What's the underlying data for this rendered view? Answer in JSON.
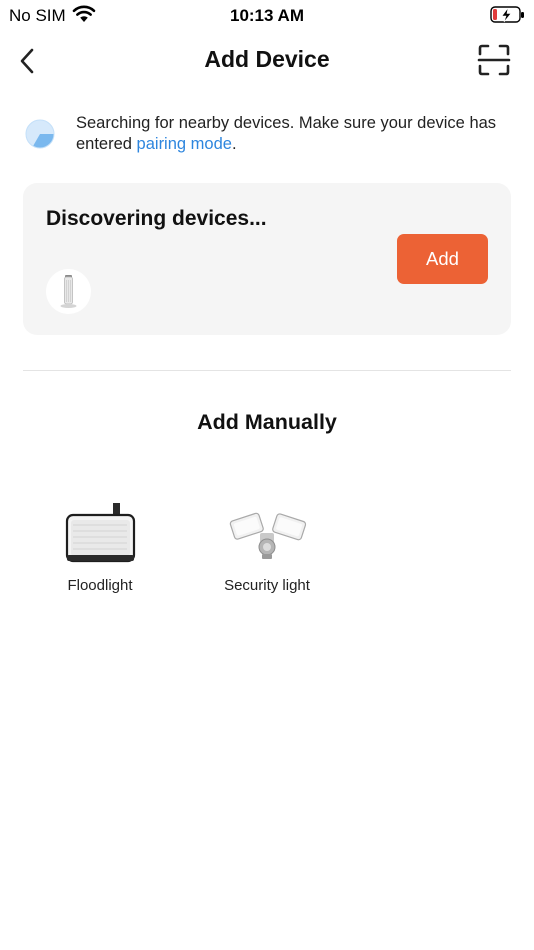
{
  "status_bar": {
    "carrier": "No SIM",
    "time": "10:13 AM"
  },
  "nav": {
    "title": "Add Device"
  },
  "search_info": {
    "text_before": "Searching for nearby devices. Make sure your device has entered ",
    "link_text": "pairing mode",
    "text_after": "."
  },
  "discover_card": {
    "title": "Discovering devices...",
    "add_label": "Add",
    "add_color": "#ec6235"
  },
  "manual": {
    "title": "Add Manually",
    "devices": [
      {
        "label": "Floodlight",
        "icon": "floodlight-icon"
      },
      {
        "label": "Security light",
        "icon": "security-light-icon"
      }
    ]
  },
  "colors": {
    "accent": "#ec6235",
    "link": "#2e86de",
    "card_bg": "#f5f5f5"
  }
}
